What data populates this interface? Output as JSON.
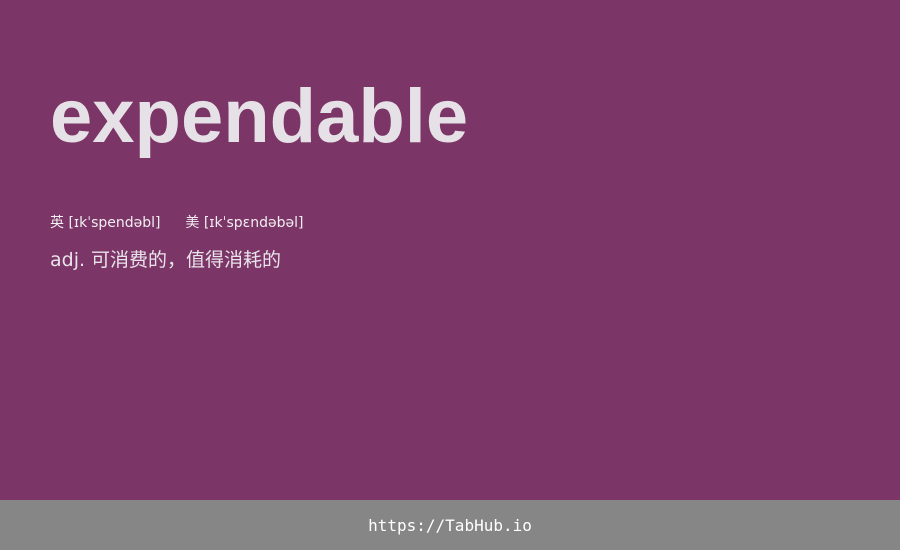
{
  "card": {
    "word": "expendable",
    "phonetics": {
      "uk_label": "英",
      "uk": "[ɪkˈspendəbl]",
      "us_label": "美",
      "us": "[ɪkˈspɛndəbəl]"
    },
    "definition": "adj. 可消费的，值得消耗的"
  },
  "footer": {
    "link": "https://TabHub.io"
  },
  "colors": {
    "background": "#7b3566",
    "footer_background": "#868686"
  }
}
